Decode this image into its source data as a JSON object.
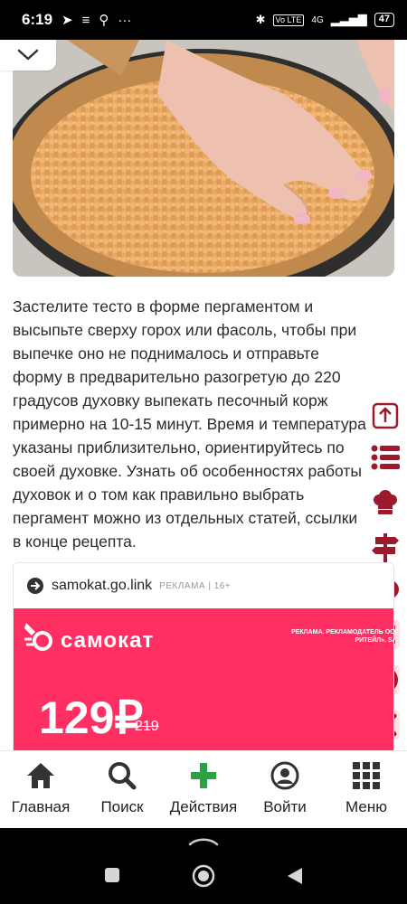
{
  "status_bar": {
    "time": "6:19",
    "network": "4G",
    "battery": "47"
  },
  "article": {
    "paragraph": "Застелите тесто в форме пергаментом и высыпьте сверху горох или фасоль, чтобы при выпечке оно не поднималось и отправьте форму в предварительно разогретую до 220 градусов духовку выпекать песочный корж примерно на 10-15 минут. Время и температура указаны приблизительно, ориентируйтесь по своей духовке. Узнать об особенностях работы духовок и о том как правильно выбрать пергамент можно из отдельных статей, ссылки в конце рецепта."
  },
  "ad": {
    "domain": "samokat.go.link",
    "meta": "РЕКЛАМА | 16+",
    "brand": "самокат",
    "legal": "РЕКЛАМА. РЕКЛАМОДАТЕЛЬ ООО «УМНЫЙ РИТЕЙЛ». SAMOKAT.RU",
    "price": "129₽",
    "old_price": "219",
    "banner_color": "#ff2e63"
  },
  "side_toolbar": {
    "accent_color": "#9b1a2b",
    "icons": [
      "scroll-up-icon",
      "list-icon",
      "chef-hat-icon",
      "signpost-icon",
      "comment-icon",
      "share-icon",
      "help-icon",
      "close-icon"
    ]
  },
  "bottom_nav": {
    "items": [
      {
        "label": "Главная",
        "icon": "home-icon"
      },
      {
        "label": "Поиск",
        "icon": "search-icon"
      },
      {
        "label": "Действия",
        "icon": "plus-icon"
      },
      {
        "label": "Войти",
        "icon": "user-icon"
      },
      {
        "label": "Меню",
        "icon": "grid-icon"
      }
    ],
    "plus_color": "#2aa147"
  }
}
